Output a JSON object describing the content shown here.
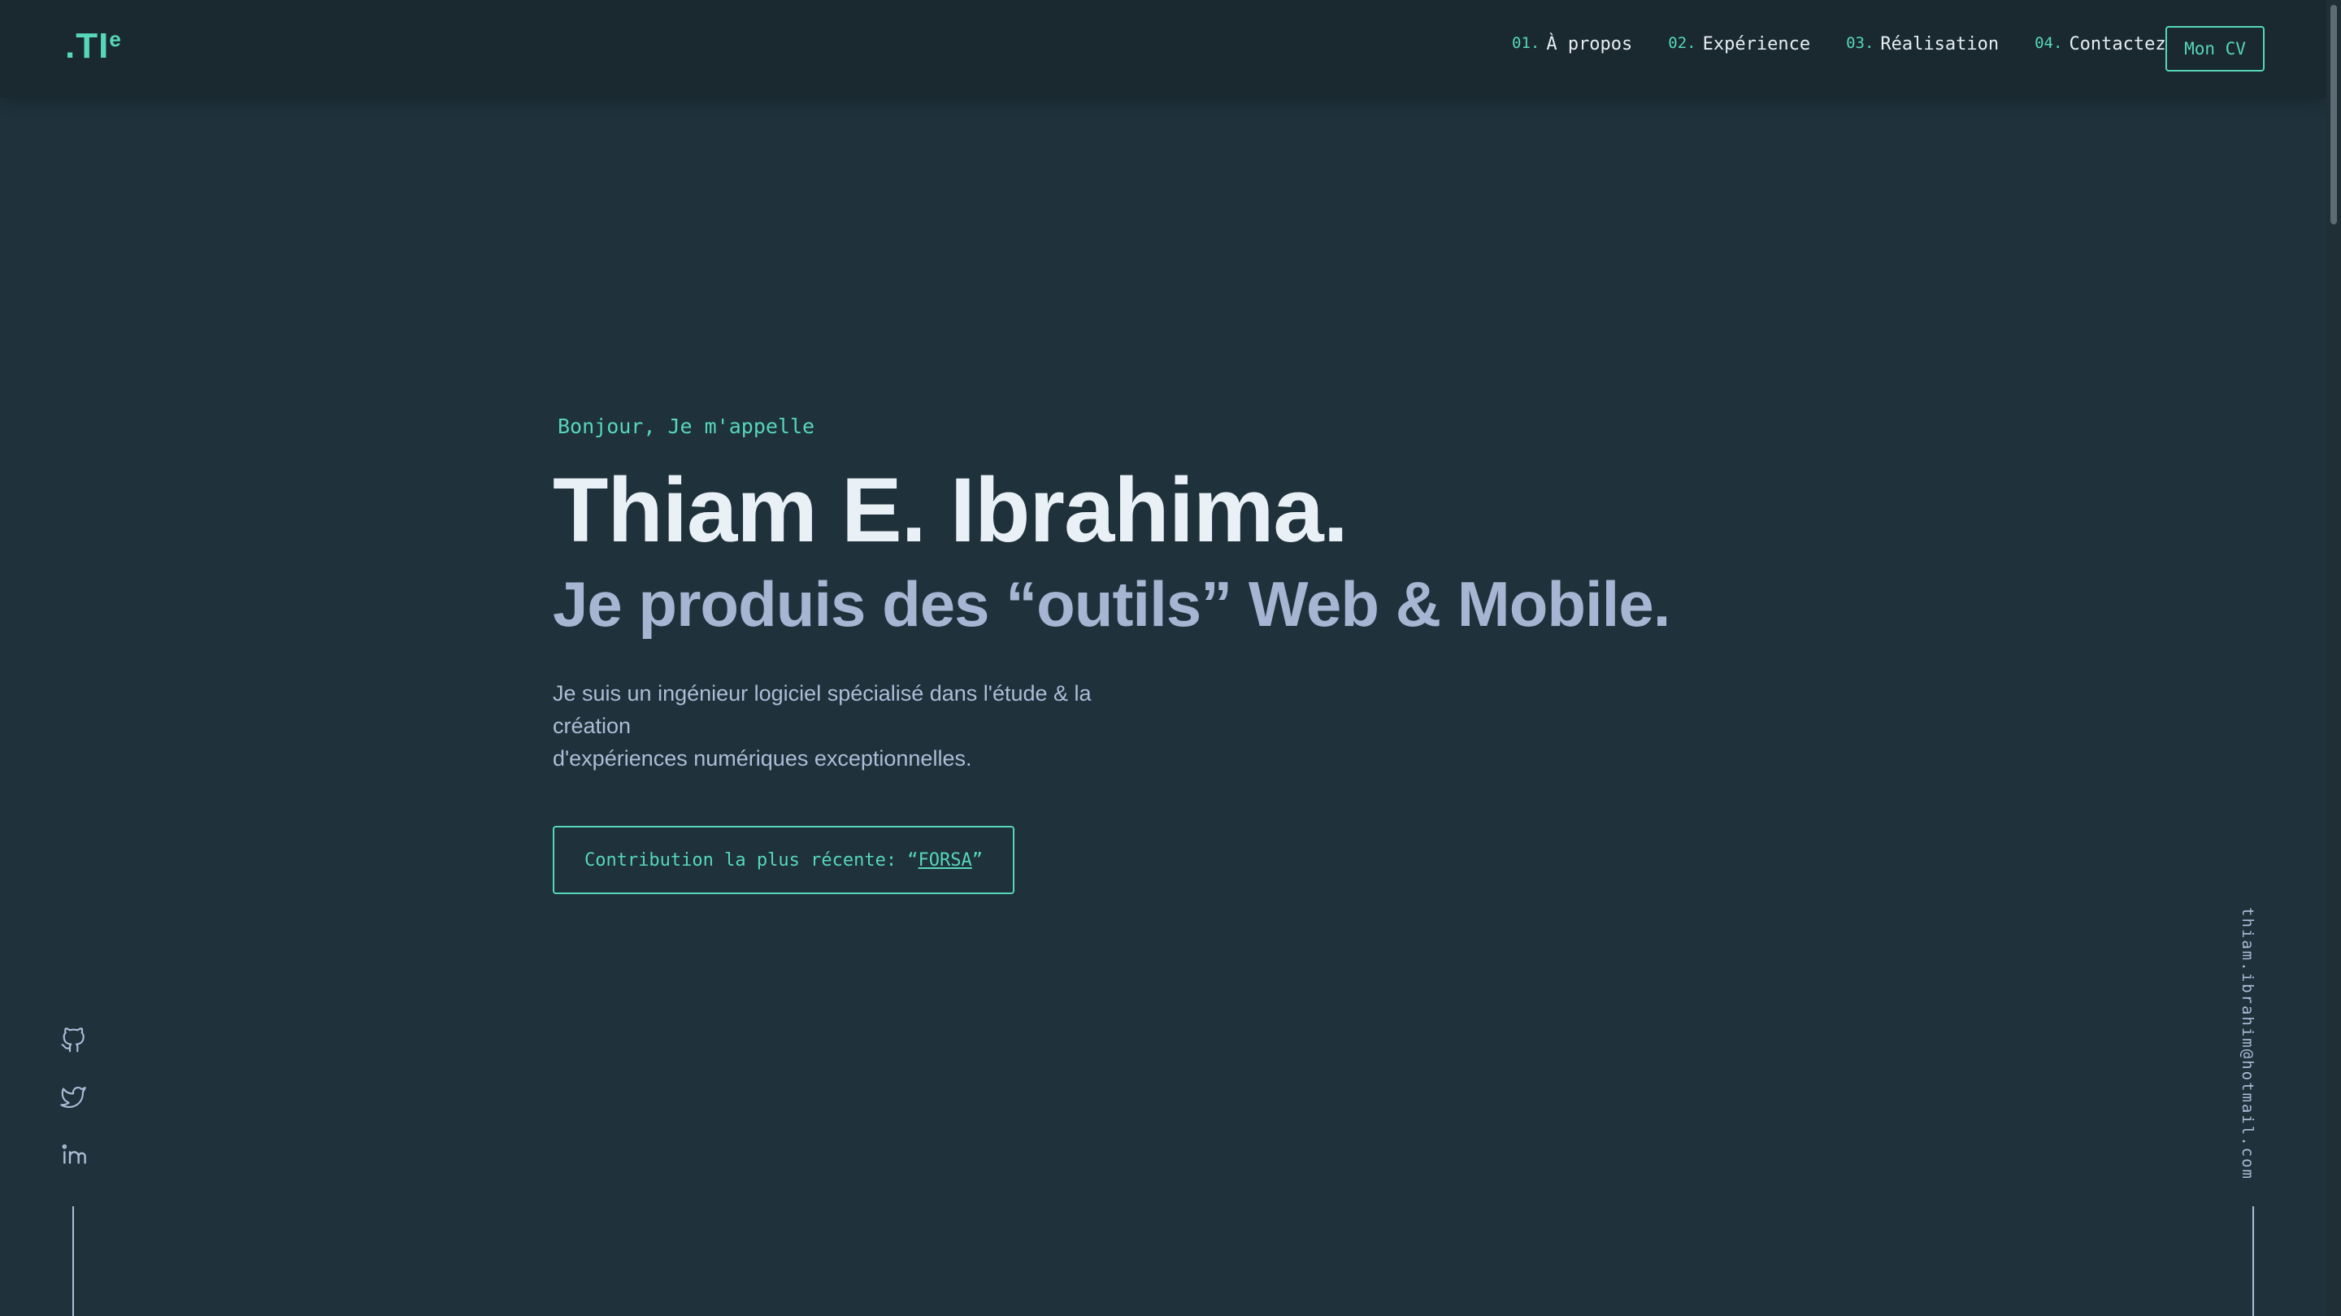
{
  "header": {
    "logo_main": ".TI",
    "logo_sup": "e",
    "nav": [
      {
        "num": "01.",
        "label": "À propos"
      },
      {
        "num": "02.",
        "label": "Expérience"
      },
      {
        "num": "03.",
        "label": "Réalisation"
      },
      {
        "num": "04.",
        "label": "Contactez"
      }
    ],
    "cv_label": "Mon CV"
  },
  "hero": {
    "greeting": "Bonjour, Je m'appelle",
    "name": "Thiam E. Ibrahima.",
    "tagline": "Je produis des “outils” Web & Mobile.",
    "description_line1": "Je suis un ingénieur logiciel spécialisé dans l'étude & la création",
    "description_line2": "d'expériences numériques exceptionnelles.",
    "cta_prefix": "Contribution la plus récente: “",
    "cta_link": "FORSA",
    "cta_suffix": "”"
  },
  "sidebar": {
    "socials": [
      {
        "icon": "github-icon"
      },
      {
        "icon": "twitter-icon"
      },
      {
        "icon": "linkedin-icon"
      }
    ],
    "email": "thiam.ibrahim@hotmail.com"
  },
  "colors": {
    "background": "#1f313b",
    "header": "#1a2830",
    "accent": "#56d7ba",
    "heading": "#e9f1f7",
    "muted": "#a7b4d2"
  }
}
